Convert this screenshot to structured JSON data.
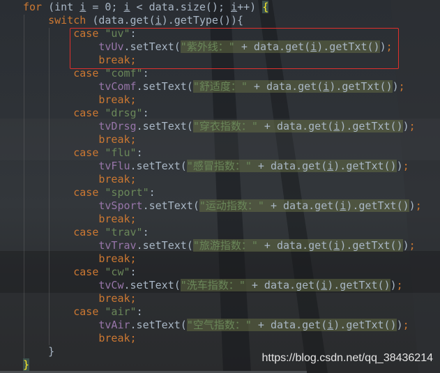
{
  "editor": {
    "lines": [
      [
        [
          "",
          "for"
        ],
        [
          "kw",
          ""
        ],
        [
          "",
          " (int "
        ],
        [
          "ul",
          "i"
        ],
        [
          "",
          " = 0; "
        ],
        [
          "ul",
          "i"
        ],
        [
          "",
          " < data.size(); "
        ],
        [
          "ul",
          "i"
        ],
        [
          "",
          "++) "
        ],
        [
          "brace",
          "{"
        ]
      ],
      [
        [
          "",
          "    "
        ],
        [
          "kw",
          "switch"
        ],
        [
          "",
          " (data.get("
        ],
        [
          "ul",
          "i"
        ],
        [
          "",
          ").getType()){"
        ]
      ],
      [
        [
          "",
          "        "
        ],
        [
          "kw",
          "case "
        ],
        [
          "str",
          "\"uv\""
        ],
        [
          "",
          ":"
        ]
      ],
      [
        [
          "",
          "            "
        ],
        [
          "fld",
          "tvUv"
        ],
        [
          "",
          ".setText("
        ],
        [
          "strh",
          "\"紫外线：\""
        ],
        [
          "hl",
          " + data.get("
        ],
        [
          "hlul",
          "i"
        ],
        [
          "hl",
          ").getTxt()"
        ],
        [
          "",
          ")"
        ],
        [
          "kw",
          ";"
        ]
      ],
      [
        [
          "",
          "            "
        ],
        [
          "kw",
          "break;"
        ]
      ],
      [
        [
          "",
          "        "
        ],
        [
          "kw",
          "case "
        ],
        [
          "str",
          "\"comf\""
        ],
        [
          "",
          ":"
        ]
      ],
      [
        [
          "",
          "            "
        ],
        [
          "fld",
          "tvComf"
        ],
        [
          "",
          ".setText("
        ],
        [
          "strh",
          "\"舒适度：\""
        ],
        [
          "hl",
          " + data.get("
        ],
        [
          "hlul",
          "i"
        ],
        [
          "hl",
          ").getTxt()"
        ],
        [
          "",
          ")"
        ],
        [
          "kw",
          ";"
        ]
      ],
      [
        [
          "",
          "            "
        ],
        [
          "kw",
          "break;"
        ]
      ],
      [
        [
          "",
          "        "
        ],
        [
          "kw",
          "case "
        ],
        [
          "str",
          "\"drsg\""
        ],
        [
          "",
          ":"
        ]
      ],
      [
        [
          "",
          "            "
        ],
        [
          "fld",
          "tvDrsg"
        ],
        [
          "",
          ".setText("
        ],
        [
          "strh",
          "\"穿衣指数：\""
        ],
        [
          "hl",
          " + data.get("
        ],
        [
          "hlul",
          "i"
        ],
        [
          "hl",
          ").getTxt()"
        ],
        [
          "",
          ")"
        ],
        [
          "kw",
          ";"
        ]
      ],
      [
        [
          "",
          "            "
        ],
        [
          "kw",
          "break;"
        ]
      ],
      [
        [
          "",
          "        "
        ],
        [
          "kw",
          "case "
        ],
        [
          "str",
          "\"flu\""
        ],
        [
          "",
          ":"
        ]
      ],
      [
        [
          "",
          "            "
        ],
        [
          "fld",
          "tvFlu"
        ],
        [
          "",
          ".setText("
        ],
        [
          "strh",
          "\"感冒指数：\""
        ],
        [
          "hl",
          " + data.get("
        ],
        [
          "hlul",
          "i"
        ],
        [
          "hl",
          ").getTxt()"
        ],
        [
          "",
          ")"
        ],
        [
          "kw",
          ";"
        ]
      ],
      [
        [
          "",
          "            "
        ],
        [
          "kw",
          "break;"
        ]
      ],
      [
        [
          "",
          "        "
        ],
        [
          "kw",
          "case "
        ],
        [
          "str",
          "\"sport\""
        ],
        [
          "",
          ":"
        ]
      ],
      [
        [
          "",
          "            "
        ],
        [
          "fld",
          "tvSport"
        ],
        [
          "",
          ".setText("
        ],
        [
          "strh",
          "\"运动指数：\""
        ],
        [
          "hl",
          " + data.get("
        ],
        [
          "hlul",
          "i"
        ],
        [
          "hl",
          ").getTxt()"
        ],
        [
          "",
          ")"
        ],
        [
          "kw",
          ";"
        ]
      ],
      [
        [
          "",
          "            "
        ],
        [
          "kw",
          "break;"
        ]
      ],
      [
        [
          "",
          "        "
        ],
        [
          "kw",
          "case "
        ],
        [
          "str",
          "\"trav\""
        ],
        [
          "",
          ":"
        ]
      ],
      [
        [
          "",
          "            "
        ],
        [
          "fld",
          "tvTrav"
        ],
        [
          "",
          ".setText("
        ],
        [
          "strh",
          "\"旅游指数：\""
        ],
        [
          "hl",
          " + data.get("
        ],
        [
          "hlul",
          "i"
        ],
        [
          "hl",
          ").getTxt()"
        ],
        [
          "",
          ")"
        ],
        [
          "kw",
          ";"
        ]
      ],
      [
        [
          "",
          "            "
        ],
        [
          "kw",
          "break;"
        ]
      ],
      [
        [
          "",
          "        "
        ],
        [
          "kw",
          "case "
        ],
        [
          "str",
          "\"cw\""
        ],
        [
          "",
          ":"
        ]
      ],
      [
        [
          "",
          "            "
        ],
        [
          "fld",
          "tvCw"
        ],
        [
          "",
          ".setText("
        ],
        [
          "strh",
          "\"洗车指数：\""
        ],
        [
          "hl",
          " + data.get("
        ],
        [
          "hlul",
          "i"
        ],
        [
          "hl",
          ").getTxt()"
        ],
        [
          "",
          ")"
        ],
        [
          "kw",
          ";"
        ]
      ],
      [
        [
          "",
          "            "
        ],
        [
          "kw",
          "break;"
        ]
      ],
      [
        [
          "",
          "        "
        ],
        [
          "kw",
          "case "
        ],
        [
          "str",
          "\"air\""
        ],
        [
          "",
          ":"
        ]
      ],
      [
        [
          "",
          "            "
        ],
        [
          "fld",
          "tvAir"
        ],
        [
          "",
          ".setText("
        ],
        [
          "strh",
          "\"空气指数：\""
        ],
        [
          "hl",
          " + data.get("
        ],
        [
          "hlul",
          "i"
        ],
        [
          "hl",
          ").getTxt()"
        ],
        [
          "",
          ")"
        ],
        [
          "kw",
          ";"
        ]
      ],
      [
        [
          "",
          "            "
        ],
        [
          "kw",
          "break;"
        ]
      ],
      [
        [
          "",
          "    }"
        ]
      ],
      [
        [
          "brace",
          "}"
        ]
      ]
    ]
  },
  "watermark": "https://blog.csdn.net/qq_38436214",
  "colors": {
    "keyword": "#cc7832",
    "string": "#6a8759",
    "field": "#9876aa",
    "text": "#a9b7c6",
    "highlight_box": "#e0302c",
    "brace_match": "#ffef28"
  }
}
